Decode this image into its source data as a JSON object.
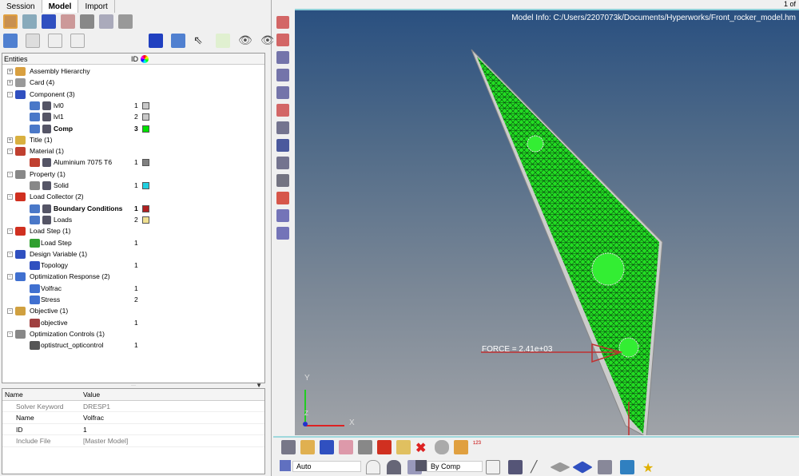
{
  "tabs": [
    "Session",
    "Model",
    "Import"
  ],
  "page_indicator": "1 of",
  "tree": {
    "col_entities": "Entities",
    "col_id": "ID",
    "rows": [
      {
        "label": "Assembly Hierarchy",
        "level": 0,
        "exp": "+",
        "icon": "#d9a040"
      },
      {
        "label": "Card (4)",
        "level": 0,
        "exp": "+",
        "icon": "#999"
      },
      {
        "label": "Component (3)",
        "level": 0,
        "exp": "-",
        "icon": "#3050c0"
      },
      {
        "label": "lvl0",
        "level": 1,
        "id": "1",
        "color": "#c8c8c8",
        "icon": "#4a78c8"
      },
      {
        "label": "lvl1",
        "level": 1,
        "id": "2",
        "color": "#c8c8c8",
        "icon": "#4a78c8"
      },
      {
        "label": "Comp",
        "level": 1,
        "id": "3",
        "color": "#00e000",
        "bold": true,
        "icon": "#4a78c8"
      },
      {
        "label": "Title (1)",
        "level": 0,
        "exp": "+",
        "icon": "#d9b040"
      },
      {
        "label": "Material (1)",
        "level": 0,
        "exp": "-",
        "icon": "#c04030"
      },
      {
        "label": "Aluminium 7075 T6",
        "level": 1,
        "id": "1",
        "color": "#808080",
        "icon": "#c04030"
      },
      {
        "label": "Property (1)",
        "level": 0,
        "exp": "-",
        "icon": "#888"
      },
      {
        "label": "Solid",
        "level": 1,
        "id": "1",
        "color": "#20d0e0",
        "icon": "#888"
      },
      {
        "label": "Load Collector (2)",
        "level": 0,
        "exp": "-",
        "icon": "#d03020"
      },
      {
        "label": "Boundary Conditions",
        "level": 1,
        "id": "1",
        "color": "#b02020",
        "bold": true,
        "icon": "#4a78c8"
      },
      {
        "label": "Loads",
        "level": 1,
        "id": "2",
        "color": "#f0e090",
        "icon": "#4a78c8"
      },
      {
        "label": "Load Step (1)",
        "level": 0,
        "exp": "-",
        "icon": "#d03020"
      },
      {
        "label": "Load Step",
        "level": 1,
        "id": "1",
        "icon": "#30a030"
      },
      {
        "label": "Design Variable (1)",
        "level": 0,
        "exp": "-",
        "icon": "#3050c0"
      },
      {
        "label": "Topology",
        "level": 1,
        "id": "1",
        "icon": "#3050c0"
      },
      {
        "label": "Optimization Response (2)",
        "level": 0,
        "exp": "-",
        "icon": "#4070d0"
      },
      {
        "label": "Volfrac",
        "level": 1,
        "id": "1",
        "icon": "#4070d0"
      },
      {
        "label": "Stress",
        "level": 1,
        "id": "2",
        "icon": "#4070d0"
      },
      {
        "label": "Objective (1)",
        "level": 0,
        "exp": "-",
        "icon": "#d0a040"
      },
      {
        "label": "objective",
        "level": 1,
        "id": "1",
        "icon": "#a04040"
      },
      {
        "label": "Optimization Controls (1)",
        "level": 0,
        "exp": "-",
        "icon": "#888"
      },
      {
        "label": "optistruct_opticontrol",
        "level": 1,
        "id": "1",
        "icon": "#555"
      }
    ]
  },
  "props": {
    "col_name": "Name",
    "col_value": "Value",
    "rows": [
      {
        "name": "Solver Keyword",
        "value": "DRESP1",
        "muted": true
      },
      {
        "name": "Name",
        "value": "Volfrac"
      },
      {
        "name": "ID",
        "value": "1"
      },
      {
        "name": "Include File",
        "value": "[Master Model]",
        "muted": true
      }
    ]
  },
  "viewport": {
    "model_info": "Model Info: C:/Users/2207073k/Documents/Hyperworks/Front_rocker_model.hm",
    "force_label": "FORCE = 2.41e+03",
    "axis_x": "X",
    "axis_y": "Y",
    "axis_z": "Z",
    "mesh_color": "#22dd22",
    "bg_top": "#2a5080"
  },
  "bottom": {
    "auto_select": "Auto",
    "color_select": "By Comp"
  }
}
